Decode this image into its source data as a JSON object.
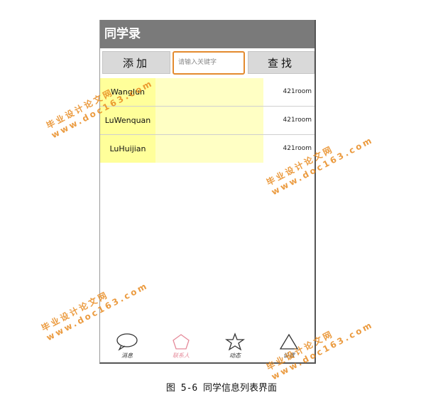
{
  "app": {
    "title": "同学录"
  },
  "toolbar": {
    "add_label": "添加",
    "search_placeholder": "请输入关键字",
    "find_label": "查找"
  },
  "contacts": [
    {
      "name": "WangJun",
      "room": "421room"
    },
    {
      "name": "LuWenquan",
      "room": "421room"
    },
    {
      "name": "LuHuijian",
      "room": "421room"
    }
  ],
  "tabs": [
    {
      "label": "消息",
      "icon": "chat-bubble-icon"
    },
    {
      "label": "联系人",
      "icon": "pentagon-icon"
    },
    {
      "label": "动态",
      "icon": "star-icon"
    },
    {
      "label": "设置",
      "icon": "triangle-icon"
    }
  ],
  "caption": "图 5-6 同学信息列表界面",
  "watermark": {
    "line1": "毕业设计论文网",
    "line2": "www.doc163.com"
  },
  "colors": {
    "titlebar": "#7a7a7a",
    "search_border": "#e38a2e",
    "highlight": "#ffff9a",
    "watermark": "#e88a1f"
  }
}
